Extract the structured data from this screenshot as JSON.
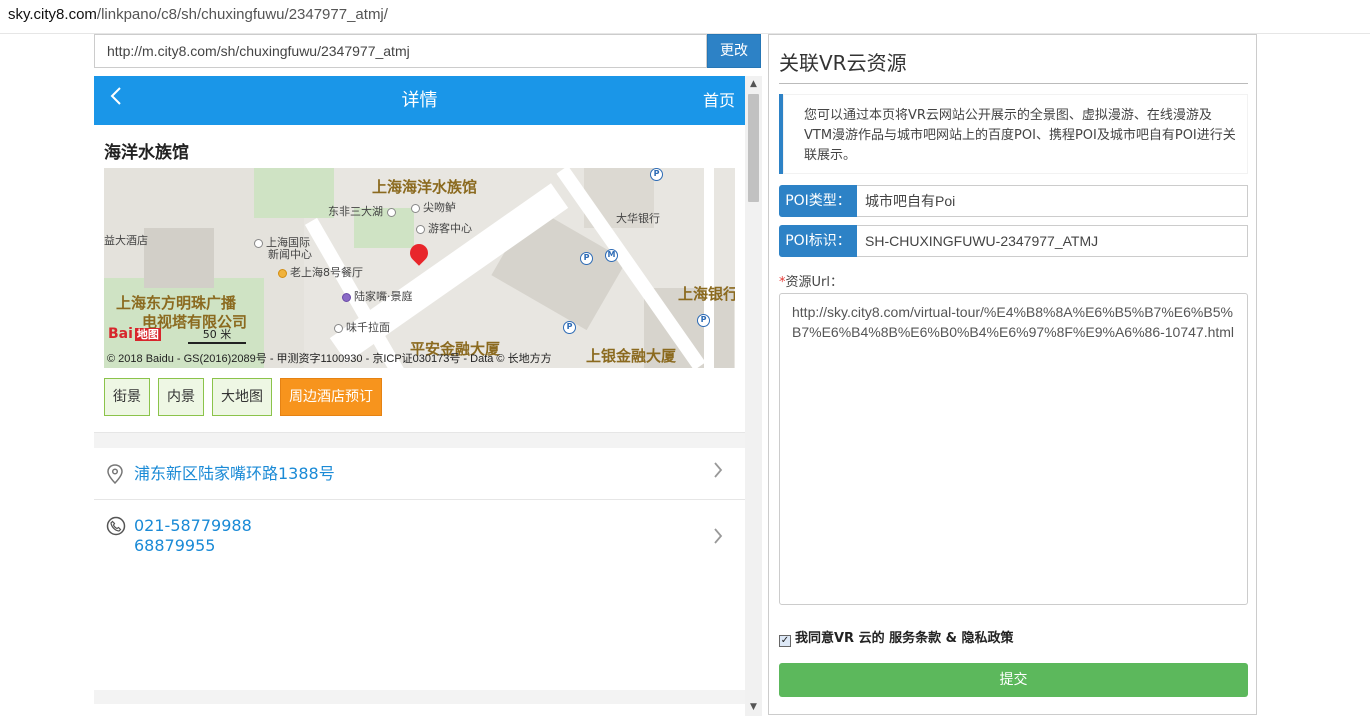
{
  "address_bar": {
    "host": "sky.city8.com",
    "path": "/linkpano/c8/sh/chuxingfuwu/2347977_atmj/"
  },
  "left": {
    "url_value": "http://m.city8.com/sh/chuxingfuwu/2347977_atmj",
    "change_label": "更改",
    "mobile": {
      "back_icon": "chevron-left-icon",
      "title": "详情",
      "home_label": "首页",
      "poi_name": "海洋水族馆",
      "map": {
        "labels_big": [
          "上海海洋水族馆",
          "上海东方明珠广播",
          "电视塔有限公司",
          "上海银行",
          "平安金融大厦",
          "上银金融大厦"
        ],
        "labels_small": [
          "东非三大湖",
          "尖吻鲈",
          "游客中心",
          "大华银行",
          "益大酒店",
          "上海国际",
          "新闻中心",
          "老上海8号餐厅",
          "陆家嘴·景庭",
          "味千拉面"
        ],
        "logo_text": "Bai",
        "logo_sub": "地图",
        "scale": "50 米",
        "copyright": "© 2018 Baidu - GS(2016)2089号 - 甲测资字1100930 - 京ICP证030173号 - Data © 长地方方"
      },
      "buttons": [
        "街景",
        "内景",
        "大地图",
        "周边酒店预订"
      ],
      "address": "浦东新区陆家嘴环路1388号",
      "phone1": "021-58779988",
      "phone2": "68879955"
    }
  },
  "right": {
    "title": "关联VR云资源",
    "notice": "您可以通过本页将VR云网站公开展示的全景图、虚拟漫游、在线漫游及VTM漫游作品与城市吧网站上的百度POI、携程POI及城市吧自有POI进行关联展示。",
    "poi_type_label": "POI类型：",
    "poi_type_value": "城市吧自有Poi",
    "poi_id_label": "POI标识：",
    "poi_id_value": "SH-CHUXINGFUWU-2347977_ATMJ",
    "res_url_required": "*",
    "res_url_label": "资源Url：",
    "res_url_value": "http://sky.city8.com/virtual-tour/%E4%B8%8A%E6%B5%B7%E6%B5%B7%E6%B4%8B%E6%B0%B4%E6%97%8F%E9%A6%86-10747.html",
    "agree_text": "我同意VR 云的 服务条款 & 隐私政策",
    "submit_label": "提交"
  },
  "colors": {
    "header_blue": "#1a96e8",
    "label_blue": "#2d82c6",
    "submit_green": "#5cb85c",
    "hotel_orange": "#f7941d",
    "link_blue": "#1a8ad6"
  }
}
